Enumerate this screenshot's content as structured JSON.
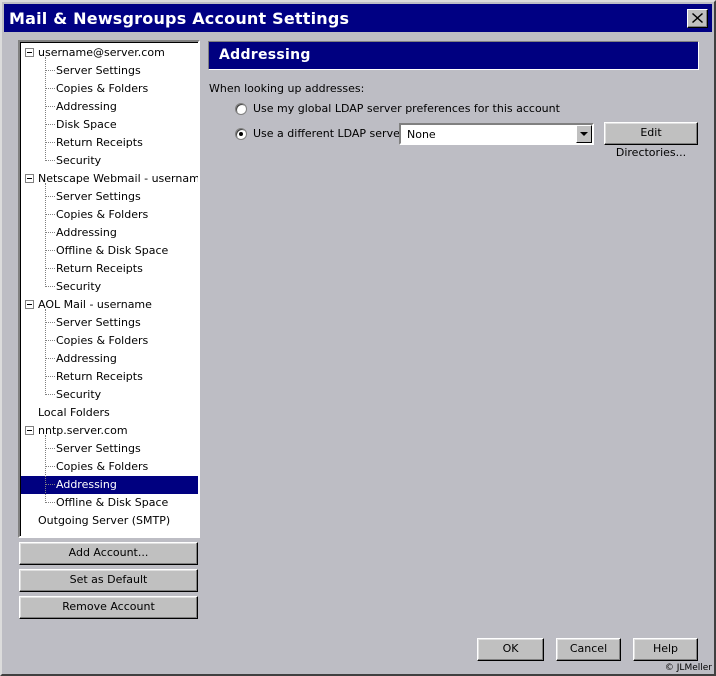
{
  "window": {
    "title": "Mail & Newsgroups Account Settings"
  },
  "tree": {
    "items": [
      {
        "label": "username@server.com",
        "level": 0,
        "expanded": true
      },
      {
        "label": "Server Settings",
        "level": 1
      },
      {
        "label": "Copies & Folders",
        "level": 1
      },
      {
        "label": "Addressing",
        "level": 1
      },
      {
        "label": "Disk Space",
        "level": 1
      },
      {
        "label": "Return Receipts",
        "level": 1
      },
      {
        "label": "Security",
        "level": 1
      },
      {
        "label": "Netscape Webmail - username",
        "level": 0,
        "expanded": true
      },
      {
        "label": "Server Settings",
        "level": 1
      },
      {
        "label": "Copies & Folders",
        "level": 1
      },
      {
        "label": "Addressing",
        "level": 1
      },
      {
        "label": "Offline & Disk Space",
        "level": 1
      },
      {
        "label": "Return Receipts",
        "level": 1
      },
      {
        "label": "Security",
        "level": 1
      },
      {
        "label": "AOL Mail - username",
        "level": 0,
        "expanded": true
      },
      {
        "label": "Server Settings",
        "level": 1
      },
      {
        "label": "Copies & Folders",
        "level": 1
      },
      {
        "label": "Addressing",
        "level": 1
      },
      {
        "label": "Return Receipts",
        "level": 1
      },
      {
        "label": "Security",
        "level": 1
      },
      {
        "label": "Local Folders",
        "level": 0
      },
      {
        "label": "nntp.server.com",
        "level": 0,
        "expanded": true
      },
      {
        "label": "Server Settings",
        "level": 1
      },
      {
        "label": "Copies & Folders",
        "level": 1
      },
      {
        "label": "Addressing",
        "level": 1,
        "selected": true
      },
      {
        "label": "Offline & Disk Space",
        "level": 1
      },
      {
        "label": "Outgoing Server (SMTP)",
        "level": 0
      }
    ]
  },
  "left_buttons": {
    "add_account": "Add Account...",
    "set_default": "Set as Default",
    "remove_account": "Remove Account"
  },
  "panel": {
    "header": "Addressing",
    "lookup_label": "When looking up addresses:",
    "option_global": "Use my global LDAP server preferences for this account",
    "option_different": "Use a different LDAP server:",
    "selected_option": "different",
    "ldap_server_value": "None",
    "edit_directories": "Edit Directories..."
  },
  "footer": {
    "ok": "OK",
    "cancel": "Cancel",
    "help": "Help",
    "copyright": "© JLMeller"
  },
  "colors": {
    "titlebar": "#000083",
    "selection": "#000080",
    "face": "#c0c0c0"
  }
}
